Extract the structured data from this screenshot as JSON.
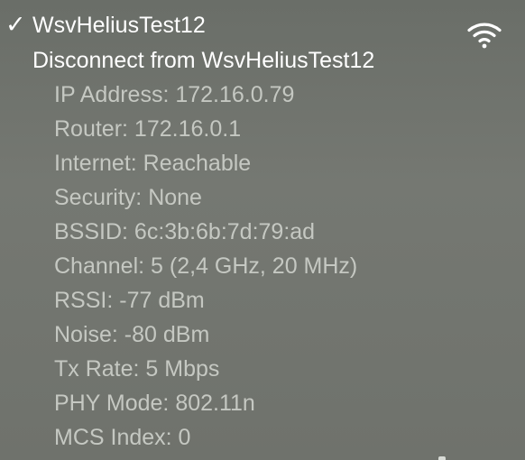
{
  "network": {
    "checkmark": "✓",
    "name": "WsvHeliusTest12",
    "disconnect_label": "Disconnect from WsvHeliusTest12",
    "wifi_icon": "wifi-icon"
  },
  "details": [
    "IP Address: 172.16.0.79",
    "Router: 172.16.0.1",
    "Internet: Reachable",
    "Security: None",
    "BSSID: 6c:3b:6b:7d:79:ad",
    "Channel: 5 (2,4 GHz, 20 MHz)",
    "RSSI: -77 dBm",
    "Noise: -80 dBm",
    "Tx Rate: 5 Mbps",
    "PHY Mode: 802.11n",
    "MCS Index: 0"
  ],
  "colors": {
    "background": "#6f736d",
    "primary_text": "#ffffff",
    "secondary_text": "#c5c8c2"
  }
}
